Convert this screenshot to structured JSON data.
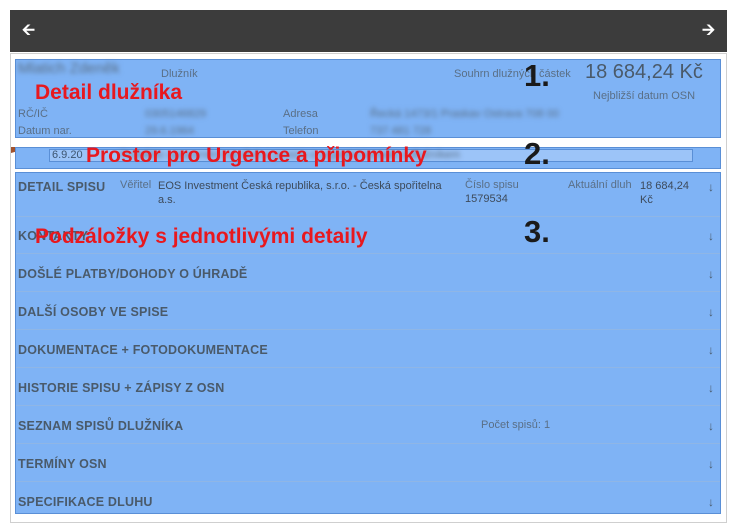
{
  "nav": {
    "back_icon": "arrow-left-icon",
    "forward_icon": "arrow-right-icon"
  },
  "debtor": {
    "name": "Mlatich Zdeněk",
    "role_label": "Dlužník",
    "summary_label": "Souhrn dlužných částek",
    "summary_amount": "18 684,24 Kč",
    "next_osn_label": "Nejbližší datum OSN",
    "id_label": "RČ/IČ",
    "id_value": "0305146829",
    "dob_label": "Datum nar.",
    "dob_value": "29.6.1964",
    "address_label": "Adresa",
    "address_value": "Řecká 1473/1 Praskav Ostrava 708 00",
    "phone_label": "Telefon",
    "phone_value": "737 481 728"
  },
  "urgence": {
    "date": "6.9.20",
    "text": "Proběhlo upozornění na dluh a prosím o urgentní kontakt s dlužníkem"
  },
  "spis": {
    "title": "DETAIL SPISU",
    "creditor_label": "Věřitel",
    "creditor_value": "EOS Investment Česká republika, s.r.o. - Česká spořitelna a.s.",
    "file_no_label": "Číslo spisu",
    "file_no_value": "1579534",
    "current_debt_label": "Aktuální dluh",
    "current_debt_value": "18 684,24 Kč"
  },
  "tabs": [
    {
      "label": "KONTAKTY"
    },
    {
      "label": "DOŠLÉ PLATBY/DOHODY O ÚHRADĚ"
    },
    {
      "label": "DALŠÍ OSOBY VE SPISE"
    },
    {
      "label": "DOKUMENTACE + FOTODOKUMENTACE"
    },
    {
      "label": "HISTORIE SPISU + ZÁPISY Z OSN"
    },
    {
      "label": "SEZNAM SPISŮ DLUŽNÍKA",
      "extra": "Počet spisů: 1"
    },
    {
      "label": "TERMÍNY OSN"
    },
    {
      "label": "SPECIFIKACE DLUHU"
    }
  ],
  "annotations": {
    "a1": "Detail dlužníka",
    "a2": "Prostor pro Urgence a připomínky",
    "a3": "Podzáložky s jednotlivými detaily",
    "n1": "1.",
    "n2": "2.",
    "n3": "3."
  },
  "colors": {
    "overlay": "#7fb3f5",
    "annotation": "#e8181e",
    "topbar": "#3c3c3c"
  }
}
